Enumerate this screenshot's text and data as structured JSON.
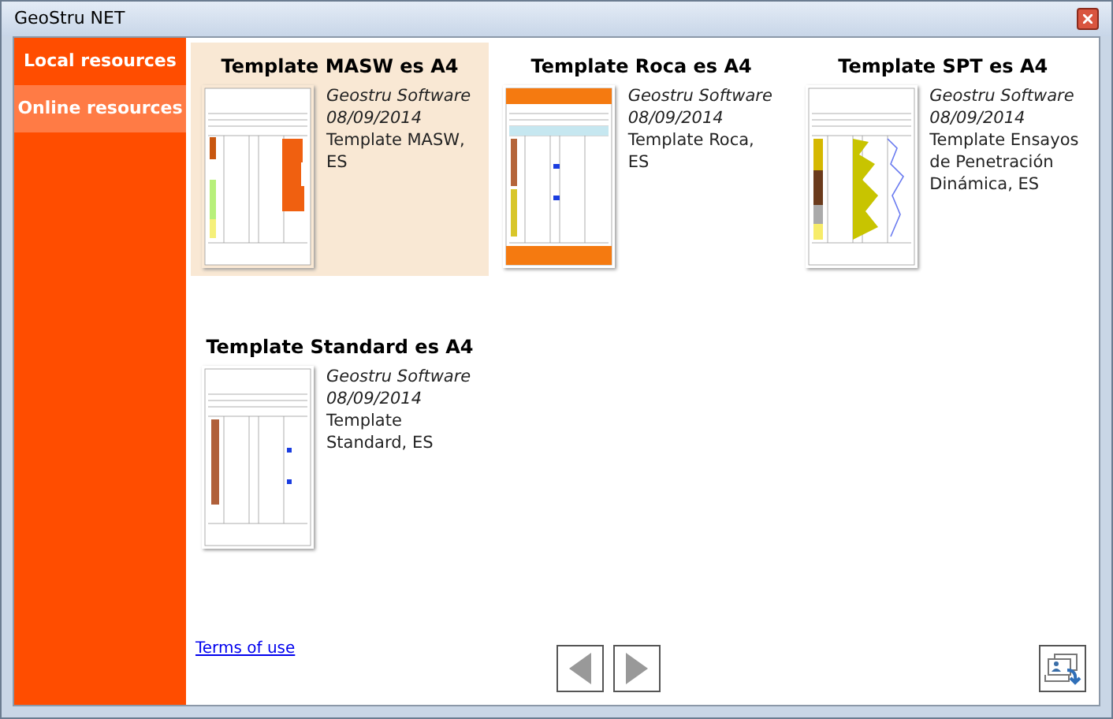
{
  "window": {
    "title": "GeoStru NET"
  },
  "sidebar": {
    "items": [
      {
        "label": "Local resources",
        "selected": false
      },
      {
        "label": "Online resources",
        "selected": true
      }
    ]
  },
  "templates": [
    {
      "title": "Template MASW es A4",
      "kind": "masw",
      "author": "Geostru Software",
      "date": "08/09/2014",
      "description": "Template MASW, ES",
      "selected": true
    },
    {
      "title": "Template Roca es A4",
      "kind": "roca",
      "author": "Geostru Software",
      "date": "08/09/2014",
      "description": "Template Roca, ES",
      "selected": false
    },
    {
      "title": "Template SPT es A4",
      "kind": "spt",
      "author": "Geostru Software",
      "date": "08/09/2014",
      "description": "Template Ensayos de Penetración Dinámica, ES",
      "selected": false
    },
    {
      "title": "Template Standard es A4",
      "kind": "standard",
      "author": "Geostru Software",
      "date": "08/09/2014",
      "description": "Template Standard, ES",
      "selected": false
    }
  ],
  "footer": {
    "link": "Terms of use"
  }
}
